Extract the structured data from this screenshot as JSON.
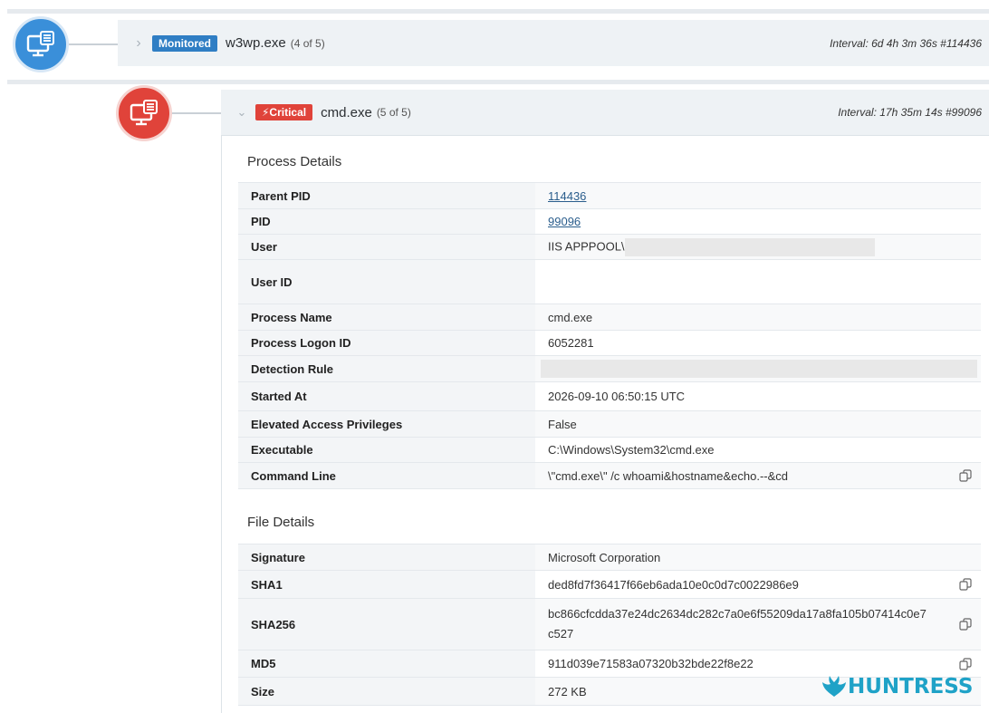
{
  "processes": [
    {
      "status": "Monitored",
      "name": "w3wp.exe",
      "count": "(4 of 5)",
      "interval": "Interval: 6d 4h 3m 36s #114436"
    },
    {
      "status": "⚡Critical",
      "name": "cmd.exe",
      "count": "(5 of 5)",
      "interval": "Interval: 17h 35m 14s #99096"
    }
  ],
  "process_details": {
    "title": "Process Details",
    "rows": [
      {
        "label": "Parent PID",
        "value": "114436"
      },
      {
        "label": "PID",
        "value": "99096"
      },
      {
        "label": "User",
        "value": "IIS APPPOOL\\"
      },
      {
        "label": "User ID",
        "value": ""
      },
      {
        "label": "Process Name",
        "value": "cmd.exe"
      },
      {
        "label": "Process Logon ID",
        "value": "6052281"
      },
      {
        "label": "Detection Rule",
        "value": ""
      },
      {
        "label": "Started At",
        "value": "2026-09-10 06:50:15 UTC"
      },
      {
        "label": "Elevated Access Privileges",
        "value": "False"
      },
      {
        "label": "Executable",
        "value": "C:\\Windows\\System32\\cmd.exe"
      },
      {
        "label": "Command Line",
        "value": "\\\"cmd.exe\\\" /c whoami&hostname&echo.--&cd"
      }
    ]
  },
  "file_details": {
    "title": "File Details",
    "rows": [
      {
        "label": "Signature",
        "value": "Microsoft Corporation"
      },
      {
        "label": "SHA1",
        "value": "ded8fd7f36417f66eb6ada10e0c0d7c0022986e9"
      },
      {
        "label": "SHA256",
        "value": "bc866cfcdda37e24dc2634dc282c7a0e6f55209da17a8fa105b07414c0e7c527"
      },
      {
        "label": "MD5",
        "value": "911d039e71583a07320b32bde22f8e22"
      },
      {
        "label": "Size",
        "value": "272 KB"
      }
    ]
  },
  "logo": {
    "text": "HUNTRESS",
    "color": "#1fa2c7"
  },
  "colors": {
    "monitored": "#2f7ec4",
    "critical": "#e0433a",
    "link": "#2a5d8c"
  }
}
